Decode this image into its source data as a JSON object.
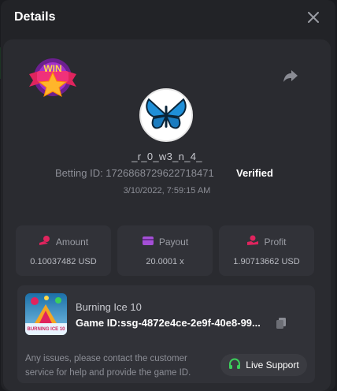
{
  "header": {
    "title": "Details"
  },
  "badge": {
    "text": "WIN"
  },
  "player": {
    "username": "_r_0_w3_n_4_",
    "betting_id": "Betting ID: 1726868729622718471",
    "status": "Verified",
    "date": "3/10/2022, 7:59:15 AM"
  },
  "stats": [
    {
      "label": "Amount",
      "value": "0.10037482 USD",
      "icon": "coins-icon",
      "icon_color": "#e0245e"
    },
    {
      "label": "Payout",
      "value": "20.0001 x",
      "icon": "wallet-icon",
      "icon_color": "#a44fd6"
    },
    {
      "label": "Profit",
      "value": "1.90713662 USD",
      "icon": "hand-coin-icon",
      "icon_color": "#e0245e"
    }
  ],
  "game": {
    "name": "Burning Ice 10",
    "game_id": "Game ID:ssg-4872e4ce-2e9f-40e8-99...",
    "thumb_text": "BURNING ICE 10"
  },
  "support": {
    "help_text": "Any issues, please contact the customer service for help and provide the game ID.",
    "button_label": "Live Support",
    "accent": "#3ccf5b"
  }
}
